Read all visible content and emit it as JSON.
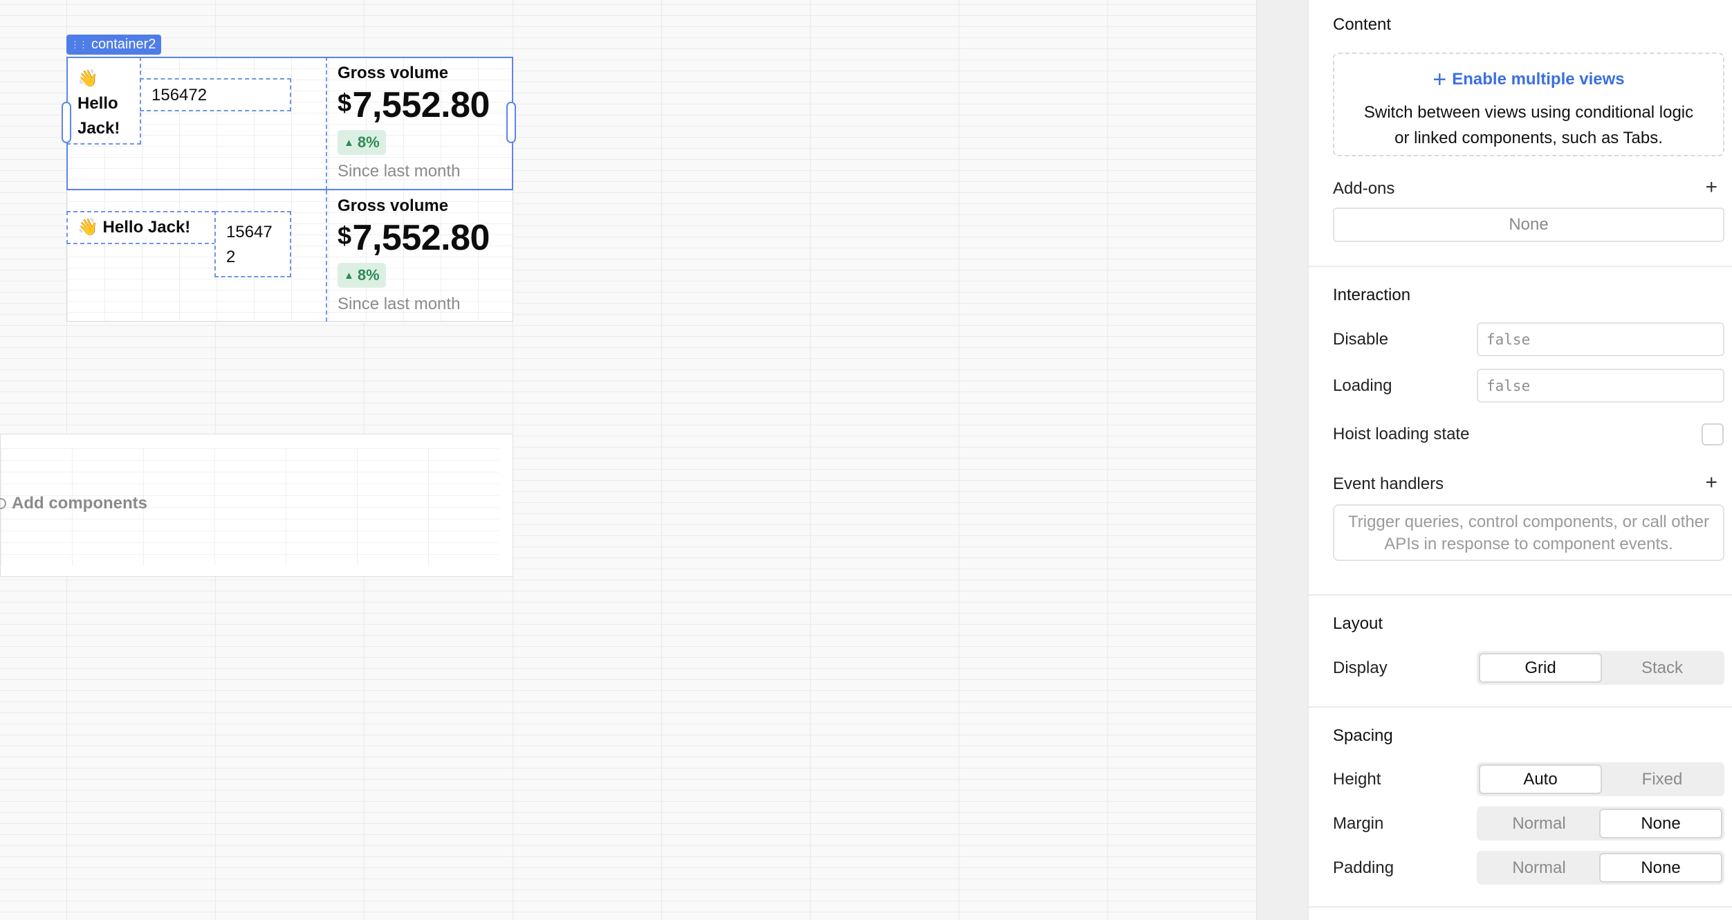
{
  "canvas": {
    "container_tag": "container2",
    "row1": {
      "greeting": "👋 Hello Jack!",
      "number": "156472",
      "stat": {
        "title": "Gross volume",
        "currency": "$",
        "value": "7,552.80",
        "change": "8%",
        "since": "Since last month"
      }
    },
    "row2": {
      "greeting": "👋 Hello Jack!",
      "number": "156472",
      "stat": {
        "title": "Gross volume",
        "currency": "$",
        "value": "7,552.80",
        "change": "8%",
        "since": "Since last month"
      }
    },
    "add_components": "Add components"
  },
  "inspector": {
    "content": {
      "title": "Content",
      "enable_views": "Enable multiple views",
      "enable_views_desc": "Switch between views using conditional logic or linked components, such as Tabs."
    },
    "addons": {
      "label": "Add-ons",
      "value": "None"
    },
    "interaction": {
      "title": "Interaction",
      "disable_label": "Disable",
      "disable_placeholder": "false",
      "loading_label": "Loading",
      "loading_placeholder": "false",
      "hoist_label": "Hoist loading state",
      "event_handlers_label": "Event handlers",
      "event_handlers_desc": "Trigger queries, control components, or call other APIs in response to component events."
    },
    "layout": {
      "title": "Layout",
      "display_label": "Display",
      "display_options": [
        "Grid",
        "Stack"
      ],
      "display_selected": "Grid"
    },
    "spacing": {
      "title": "Spacing",
      "height_label": "Height",
      "height_options": [
        "Auto",
        "Fixed"
      ],
      "height_selected": "Auto",
      "margin_label": "Margin",
      "margin_options": [
        "Normal",
        "None"
      ],
      "margin_selected": "None",
      "padding_label": "Padding",
      "padding_options": [
        "Normal",
        "None"
      ],
      "padding_selected": "None"
    }
  },
  "colors": {
    "accent": "#4f7de8",
    "positive": "#2f8a57",
    "positive_bg": "#dbf0e3"
  }
}
